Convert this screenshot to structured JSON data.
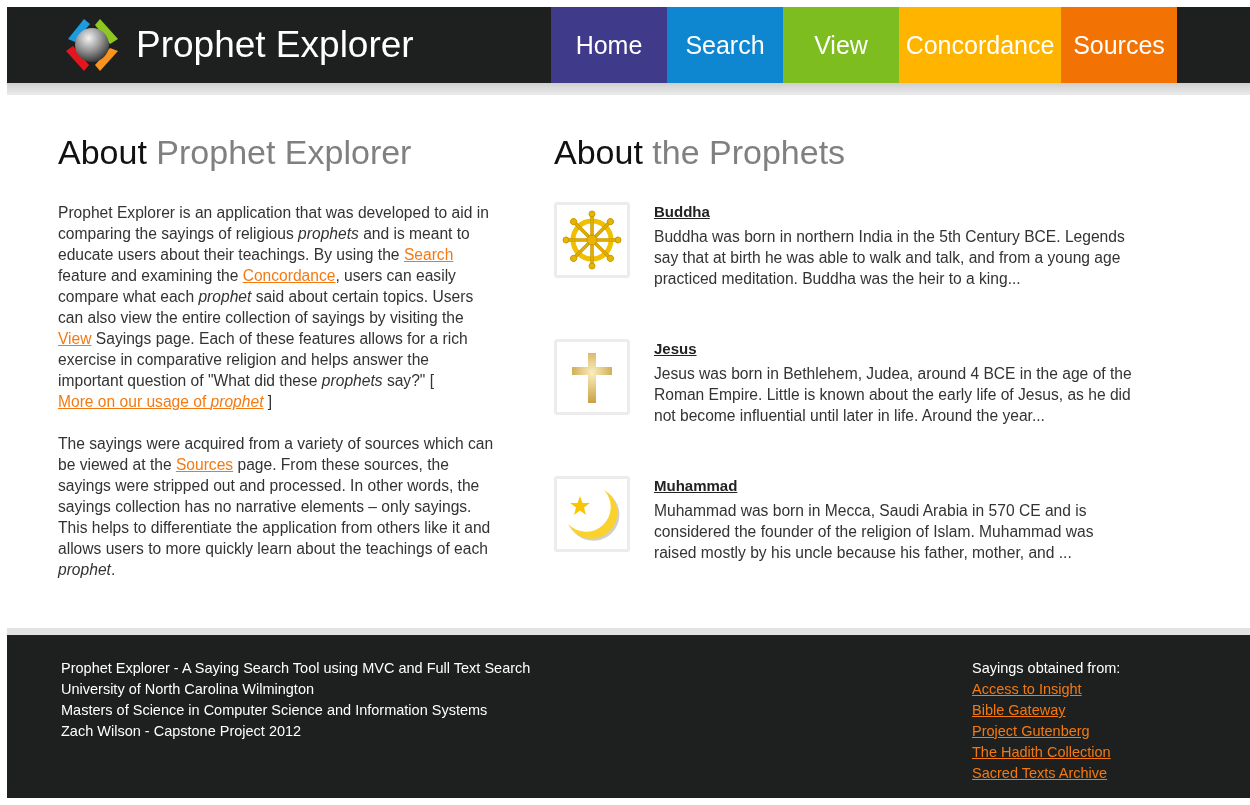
{
  "header": {
    "title": "Prophet Explorer"
  },
  "nav": [
    {
      "label": "Home",
      "color": "#3f3a8a"
    },
    {
      "label": "Search",
      "color": "#0e87d0"
    },
    {
      "label": "View",
      "color": "#7dbd1f"
    },
    {
      "label": "Concordance",
      "color": "#ffb400"
    },
    {
      "label": "Sources",
      "color": "#f37204"
    }
  ],
  "about": {
    "heading": {
      "lead": "About",
      "rest": "Prophet Explorer"
    },
    "paragraphs": [
      [
        {
          "kind": "text",
          "text": "Prophet Explorer is an application that was developed to aid in comparing the sayings of religious *prophets* and is meant to educate users about their teachings. By using the "
        },
        {
          "kind": "link",
          "text": "Search"
        },
        {
          "kind": "text",
          "text": " feature and examining the "
        },
        {
          "kind": "link",
          "text": "Concordance"
        },
        {
          "kind": "text",
          "text": ", users can easily compare what each *prophet* said about certain topics. Users can also view the entire collection of sayings by visiting the "
        },
        {
          "kind": "link",
          "text": "View"
        },
        {
          "kind": "text",
          "text": " Sayings page. Each of these features allows for a rich exercise in comparative religion and helps answer the important question of \"What did these *prophets* say?\" [ "
        },
        {
          "kind": "link",
          "text": "More on our usage of *prophet*"
        },
        {
          "kind": "text",
          "text": " ]"
        }
      ],
      [
        {
          "kind": "text",
          "text": "The sayings were acquired from a variety of sources which can be viewed at the "
        },
        {
          "kind": "link",
          "text": "Sources"
        },
        {
          "kind": "text",
          "text": " page. From these sources, the sayings were stripped out and processed. In other words, the sayings collection has no narrative elements – only sayings. This helps to differentiate the application from others like it and allows users to more quickly learn about the teachings of each *prophet*."
        }
      ]
    ]
  },
  "prophets": {
    "heading": {
      "lead": "About",
      "rest": "the Prophets"
    },
    "items": [
      {
        "name": "Buddha",
        "summary": "Buddha was born in northern India in the 5th Century BCE. Legends say that at birth he was able to walk and talk, and from a young age practiced meditation. Buddha was the heir to a king..."
      },
      {
        "name": "Jesus",
        "summary": "Jesus was born in Bethlehem, Judea, around 4 BCE in the age of the Roman Empire. Little is known about the early life of Jesus, as he did not become influential until later in life. Around the year..."
      },
      {
        "name": "Muhammad",
        "summary": "Muhammad was born in Mecca, Saudi Arabia in 570 CE and is considered the founder of the religion of Islam. Muhammad was raised mostly by his uncle because his father, mother, and ..."
      }
    ]
  },
  "footer": {
    "lines": [
      "Prophet Explorer - A Saying Search Tool using MVC and Full Text Search",
      "University of North Carolina Wilmington",
      "Masters of Science in Computer Science and Information Systems",
      "Zach Wilson - Capstone Project 2012"
    ],
    "sources_title": "Sayings obtained from:",
    "sources": [
      "Access to Insight",
      "Bible Gateway",
      "Project Gutenberg",
      "The Hadith Collection",
      "Sacred Texts Archive"
    ]
  }
}
